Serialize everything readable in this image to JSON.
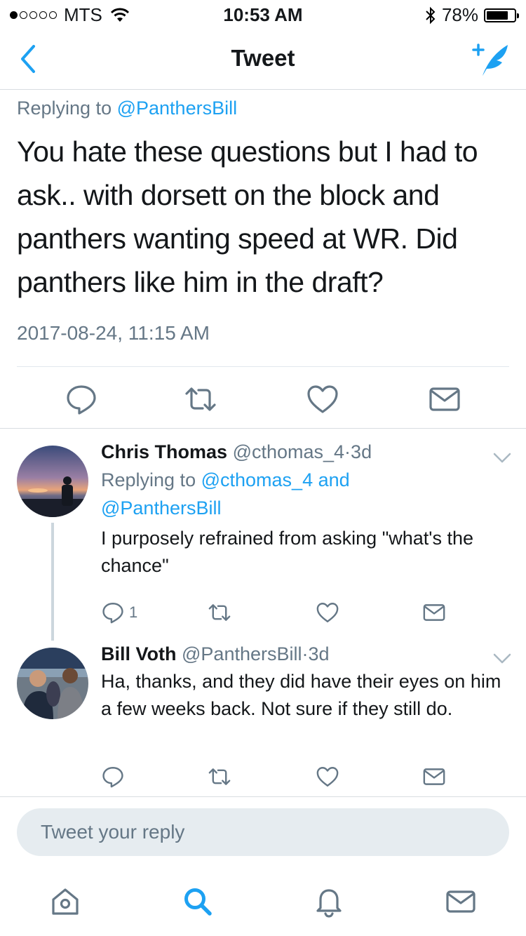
{
  "status_bar": {
    "carrier": "MTS",
    "time": "10:53 AM",
    "battery": "78%",
    "battery_level": 0.78
  },
  "nav": {
    "title": "Tweet",
    "back_icon": "chevron-left-icon",
    "compose_icon": "compose-feather-icon"
  },
  "main_tweet": {
    "replying_prefix": "Replying to",
    "replying_handle": "@PanthersBill",
    "text": "You hate these questions but I had to ask.. with dorsett on the block and panthers wanting speed at WR. Did panthers like him in the draft?",
    "timestamp": "2017-08-24, 11:15 AM"
  },
  "replies": [
    {
      "name": "Chris Thomas",
      "handle": "@cthomas_4",
      "sep": "·",
      "age": "3d",
      "replying_prefix": "Replying to",
      "replying_handle_1": "@cthomas_4",
      "replying_and": "and",
      "replying_handle_2": "@PanthersBill",
      "text": "I purposely refrained from asking \"what's the chance\"",
      "reply_count": "1"
    },
    {
      "name": "Bill Voth",
      "handle": "@PanthersBill",
      "sep": "·",
      "age": "3d",
      "text": "Ha, thanks, and they did have their eyes on him a few weeks back. Not sure if they still do.",
      "reply_count": ""
    }
  ],
  "compose": {
    "placeholder": "Tweet your reply"
  },
  "tabs": [
    "home-icon",
    "search-icon",
    "notifications-icon",
    "messages-icon"
  ],
  "colors": {
    "accent": "#1da1f2",
    "secondary_text": "#657786",
    "icon_gray": "#657786",
    "divider": "#e1e8ed"
  }
}
